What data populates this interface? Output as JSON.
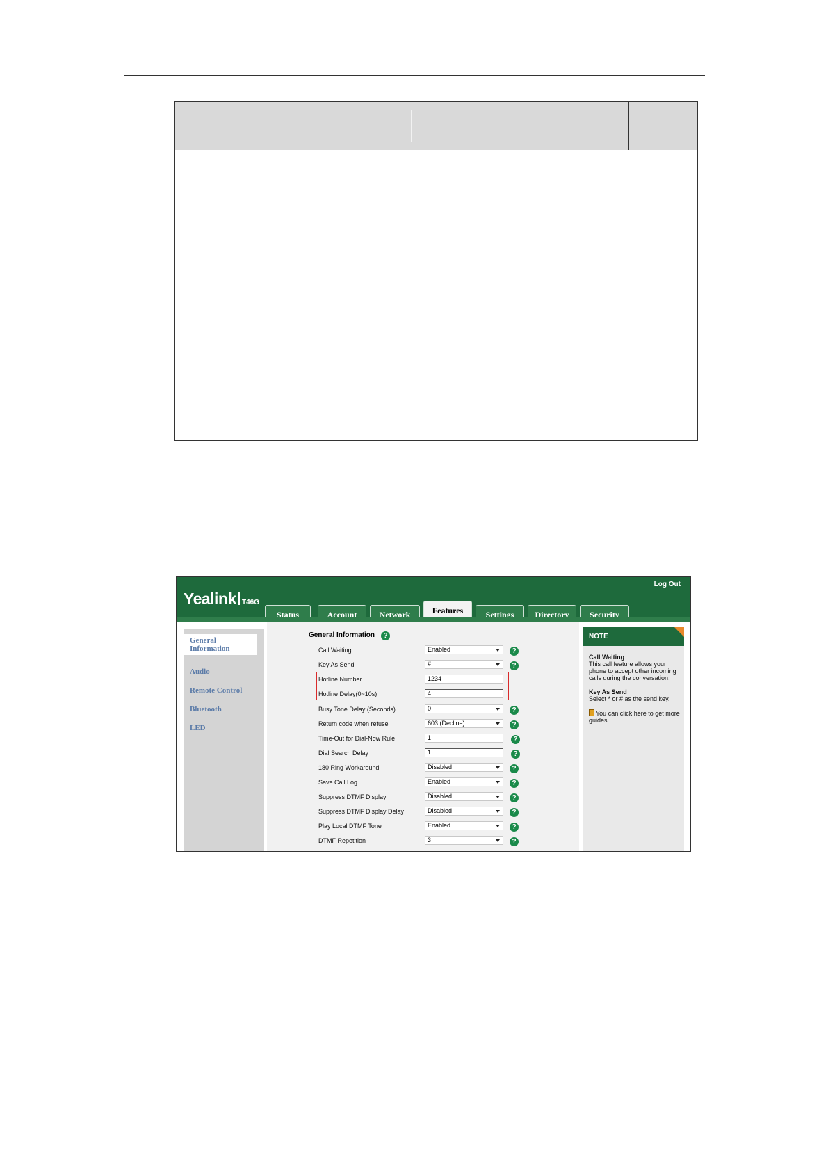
{
  "header": {
    "logo": "Yealink",
    "model": "T46G",
    "logout": "Log Out"
  },
  "tabs": [
    {
      "label": "Status"
    },
    {
      "label": "Account"
    },
    {
      "label": "Network"
    },
    {
      "label": "Features"
    },
    {
      "label": "Settings"
    },
    {
      "label": "Directory"
    },
    {
      "label": "Security"
    }
  ],
  "active_tab": "Features",
  "sidebar": {
    "items": [
      {
        "label": "General Information"
      },
      {
        "label": "Audio"
      },
      {
        "label": "Remote Control"
      },
      {
        "label": "Bluetooth"
      },
      {
        "label": "LED"
      }
    ]
  },
  "main": {
    "section_title": "General Information",
    "rows": [
      {
        "label": "Call Waiting",
        "value": "Enabled",
        "type": "select"
      },
      {
        "label": "Key As Send",
        "value": "#",
        "type": "select"
      },
      {
        "label": "Hotline Number",
        "value": "1234",
        "type": "text"
      },
      {
        "label": "Hotline Delay(0~10s)",
        "value": "4",
        "type": "text"
      },
      {
        "label": "Busy Tone Delay (Seconds)",
        "value": "0",
        "type": "select"
      },
      {
        "label": "Return code when refuse",
        "value": "603 (Decline)",
        "type": "select"
      },
      {
        "label": "Time-Out for Dial-Now Rule",
        "value": "1",
        "type": "text"
      },
      {
        "label": "Dial Search Delay",
        "value": "1",
        "type": "text"
      },
      {
        "label": "180 Ring Workaround",
        "value": "Disabled",
        "type": "select"
      },
      {
        "label": "Save Call Log",
        "value": "Enabled",
        "type": "select"
      },
      {
        "label": "Suppress DTMF Display",
        "value": "Disabled",
        "type": "select"
      },
      {
        "label": "Suppress DTMF Display Delay",
        "value": "Disabled",
        "type": "select"
      },
      {
        "label": "Play Local DTMF Tone",
        "value": "Enabled",
        "type": "select"
      },
      {
        "label": "DTMF Repetition",
        "value": "3",
        "type": "select"
      }
    ]
  },
  "note": {
    "title": "NOTE",
    "items": [
      {
        "heading": "Call Waiting",
        "text": "This call feature allows your phone to accept other incoming calls during the conversation."
      },
      {
        "heading": "Key As Send",
        "text": "Select * or # as the send key."
      }
    ],
    "guide": "You can click here to get more guides."
  },
  "colors": {
    "brand_green": "#1e6a3c",
    "highlight_red": "#d92b2b",
    "help_green": "#1a8a4a",
    "note_corner": "#e8892b"
  }
}
